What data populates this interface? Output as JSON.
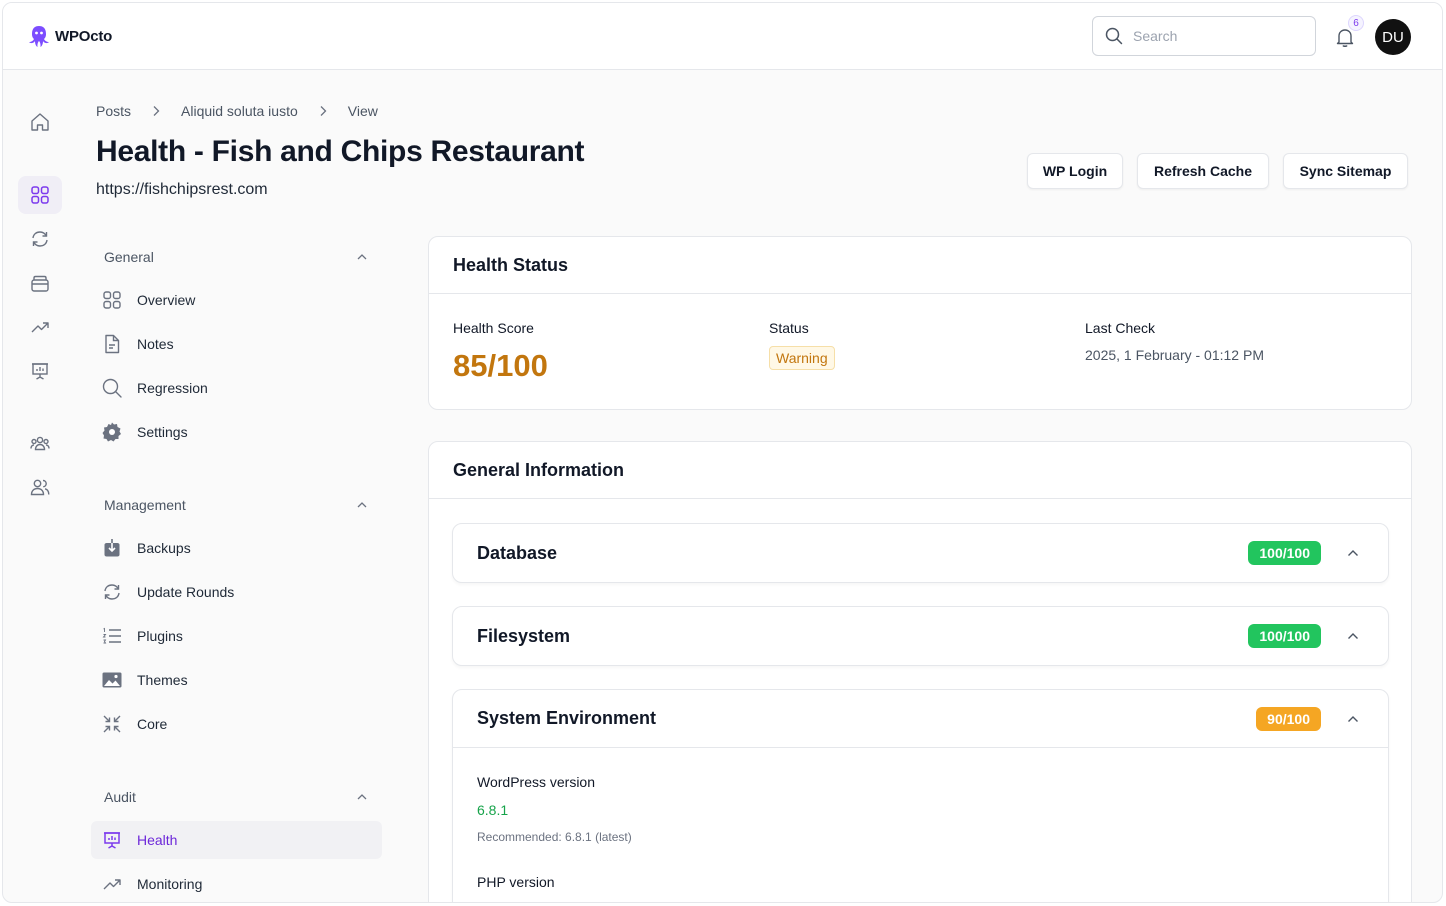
{
  "app": {
    "name": "WPOcto"
  },
  "header": {
    "search_placeholder": "Search",
    "notifications_count": "6",
    "user_initials": "DU"
  },
  "breadcrumb": [
    "Posts",
    "Aliquid soluta iusto",
    "View"
  ],
  "page": {
    "title": "Health - Fish and Chips Restaurant",
    "url": "https://fishchipsrest.com"
  },
  "actions": {
    "wp_login": "WP Login",
    "refresh_cache": "Refresh Cache",
    "sync_sitemap": "Sync Sitemap"
  },
  "subnav": {
    "general": {
      "label": "General",
      "items": [
        "Overview",
        "Notes",
        "Regression",
        "Settings"
      ]
    },
    "management": {
      "label": "Management",
      "items": [
        "Backups",
        "Update Rounds",
        "Plugins",
        "Themes",
        "Core"
      ]
    },
    "audit": {
      "label": "Audit",
      "items": [
        "Health",
        "Monitoring"
      ],
      "active": "Health"
    }
  },
  "health_status": {
    "title": "Health Status",
    "score_label": "Health Score",
    "score": "85/100",
    "status_label": "Status",
    "status": "Warning",
    "last_check_label": "Last Check",
    "last_check": "2025, 1 February - 01:12 PM"
  },
  "general_info": {
    "title": "General Information",
    "sections": [
      {
        "name": "Database",
        "score": "100/100",
        "color": "#22c55e"
      },
      {
        "name": "Filesystem",
        "score": "100/100",
        "color": "#22c55e"
      },
      {
        "name": "System Environment",
        "score": "90/100",
        "color": "#f5a623"
      }
    ],
    "details": {
      "wp_label": "WordPress version",
      "wp_value": "6.8.1",
      "wp_note": "Recommended: 6.8.1 (latest)",
      "php_label": "PHP version"
    }
  },
  "colors": {
    "accent": "#6d28d9",
    "warning": "#c2760e",
    "success": "#22c55e"
  }
}
